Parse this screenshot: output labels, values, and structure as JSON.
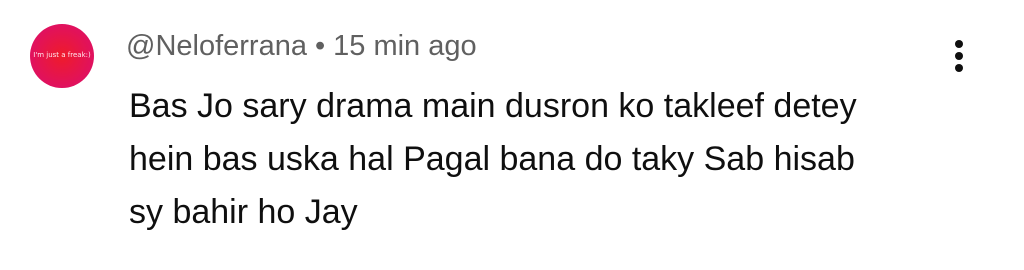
{
  "comment": {
    "avatar_text": "I'm just a freak:)",
    "author": "@Neloferrana",
    "separator": "•",
    "timestamp": "15 min ago",
    "body_lines": [
      "Bas Jo sary drama main dusron ko takleef detey",
      "hein bas uska hal Pagal bana do taky Sab hisab",
      "sy bahir ho Jay"
    ]
  },
  "icons": {
    "menu": "more-vertical-icon"
  },
  "colors": {
    "avatar_bg": "#e0115f",
    "meta_text": "#606060",
    "body_text": "#0f0f0f"
  }
}
